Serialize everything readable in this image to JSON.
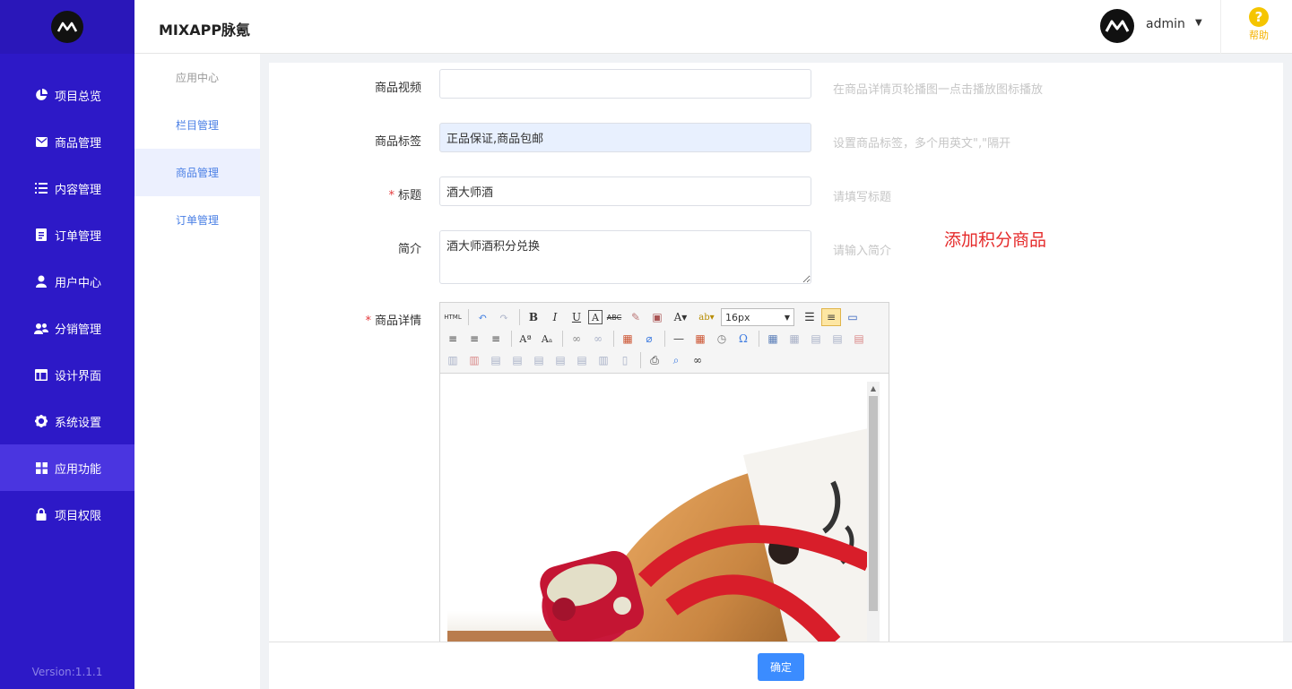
{
  "app": {
    "title": "MIXAPP脉氪",
    "version": "Version:1.1.1"
  },
  "sidebar": {
    "items": [
      {
        "label": "项目总览",
        "icon": "pie-chart-icon"
      },
      {
        "label": "商品管理",
        "icon": "envelope-icon"
      },
      {
        "label": "内容管理",
        "icon": "list-icon"
      },
      {
        "label": "订单管理",
        "icon": "document-icon"
      },
      {
        "label": "用户中心",
        "icon": "user-icon"
      },
      {
        "label": "分销管理",
        "icon": "users-icon"
      },
      {
        "label": "设计界面",
        "icon": "layout-icon"
      },
      {
        "label": "系统设置",
        "icon": "gear-icon"
      },
      {
        "label": "应用功能",
        "icon": "grid-icon",
        "active": true
      },
      {
        "label": "项目权限",
        "icon": "lock-icon"
      }
    ]
  },
  "header": {
    "username": "admin",
    "help_label": "帮助",
    "help_glyph": "?"
  },
  "subnav": {
    "items": [
      {
        "label": "应用中心"
      },
      {
        "label": "栏目管理"
      },
      {
        "label": "商品管理",
        "active": true
      },
      {
        "label": "订单管理"
      }
    ]
  },
  "form": {
    "video": {
      "label": "商品视频",
      "value": "",
      "hint": "在商品详情页轮播图一点击播放图标播放"
    },
    "tags": {
      "label": "商品标签",
      "value": "正品保证,商品包邮",
      "hint": "设置商品标签，多个用英文\",\"隔开"
    },
    "title": {
      "label": "标题",
      "required": "*",
      "value": "酒大师酒",
      "hint": "请填写标题"
    },
    "intro": {
      "label": "简介",
      "value": "酒大师酒积分兑换",
      "hint": "请输入简介"
    },
    "detail": {
      "label": "商品详情",
      "required": "*"
    },
    "annotation": "添加积分商品"
  },
  "editor": {
    "font_size": "16px"
  },
  "footer": {
    "confirm_label": "确定"
  },
  "colors": {
    "sidebar": "#2d19c7",
    "sidebar_active": "#4a35e0",
    "primary": "#3b8cff",
    "annotation": "#e52b2b",
    "help": "#f5c500"
  }
}
